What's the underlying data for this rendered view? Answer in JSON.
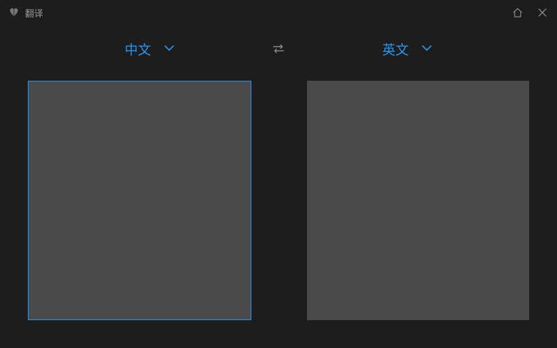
{
  "titlebar": {
    "title": "翻译"
  },
  "languages": {
    "source": "中文",
    "target": "英文"
  }
}
